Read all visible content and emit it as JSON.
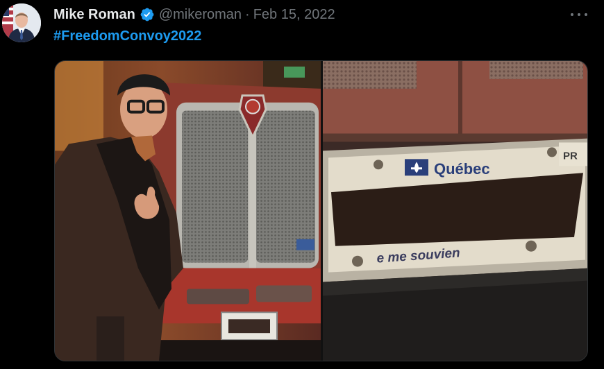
{
  "tweet": {
    "author_name": "Mike Roman",
    "handle": "@mikeroman",
    "separator": "·",
    "date": "Feb 15, 2022",
    "hashtag": "#FreedomConvoy2022"
  },
  "icons": {
    "verified": "verified-badge-icon",
    "more": "more-options-icon"
  },
  "colors": {
    "background": "#000000",
    "link": "#1d9bf0",
    "verified": "#1d9bf0",
    "muted": "#71767b"
  },
  "media": {
    "plate_province": "Québec",
    "plate_corner": "PR",
    "plate_motto": "e me souvien"
  }
}
